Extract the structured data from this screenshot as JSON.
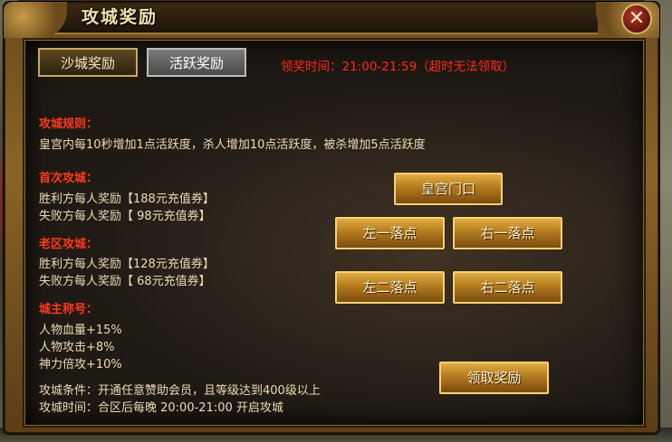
{
  "window": {
    "title": "攻城奖励",
    "close_glyph": "✕"
  },
  "tabs": [
    {
      "label": "沙城奖励",
      "active": true
    },
    {
      "label": "活跃奖励",
      "active": false
    }
  ],
  "claim_time": "领奖时间：21:00-21:59（超时无法领取）",
  "sections": {
    "rules": {
      "heading": "攻城规则：",
      "lines": [
        "皇宫内每10秒增加1点活跃度，杀人增加10点活跃度，被杀增加5点活跃度"
      ]
    },
    "first": {
      "heading": "首次攻城：",
      "lines": [
        "胜利方每人奖励【188元充值券】",
        "失败方每人奖励【 98元充值券】"
      ]
    },
    "old": {
      "heading": "老区攻城：",
      "lines": [
        "胜利方每人奖励【128元充值券】",
        "失败方每人奖励【 68元充值券】"
      ]
    },
    "title": {
      "heading": "城主称号：",
      "lines": [
        "人物血量+15%",
        "人物攻击+8%",
        "神力倍攻+10%"
      ]
    },
    "footer": {
      "lines": [
        "攻城条件：开通任意赞助会员，且等级达到400级以上",
        "攻城时间：合区后每晚 20:00-21:00 开启攻城"
      ]
    }
  },
  "buttons": {
    "palace_gate": "皇宫门口",
    "left_one": "左一落点",
    "right_one": "右一落点",
    "left_two": "左二落点",
    "right_two": "右二落点",
    "claim": "领取奖励"
  },
  "colors": {
    "heading_red": "#ff3a1c",
    "claim_time_red": "#ff2a1a",
    "body_text": "#ecdcb4",
    "gold_button": "#c48b2a"
  }
}
